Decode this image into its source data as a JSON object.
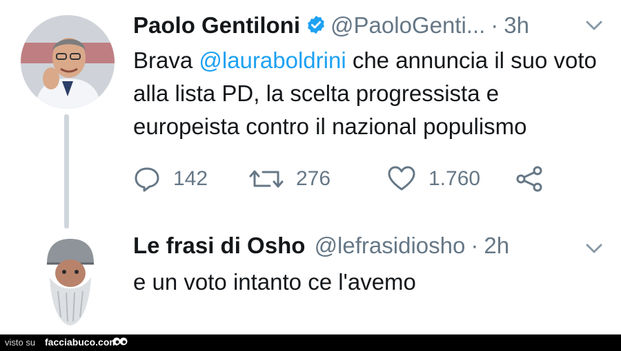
{
  "tweets": [
    {
      "author": {
        "name": "Paolo Gentiloni",
        "handle": "@PaoloGenti...",
        "verified": true
      },
      "separator": "·",
      "time": "3h",
      "text_before": "Brava ",
      "mention": "@lauraboldrini",
      "text_after": " che annuncia il suo voto alla lista PD, la scelta progressista e europeista contro il nazional populismo",
      "actions": {
        "replies": "142",
        "retweets": "276",
        "likes": "1.760"
      },
      "colors": {
        "mention": "#1da1f2",
        "verified_badge": "#1da1f2"
      }
    },
    {
      "author": {
        "name": "Le frasi di Osho",
        "handle": "@lefrasidiosho"
      },
      "separator": "·",
      "time": "2h",
      "text": "e un voto intanto ce l'avemo"
    }
  ],
  "footer": {
    "prefix": "visto su",
    "site": "facciabuco.com"
  }
}
